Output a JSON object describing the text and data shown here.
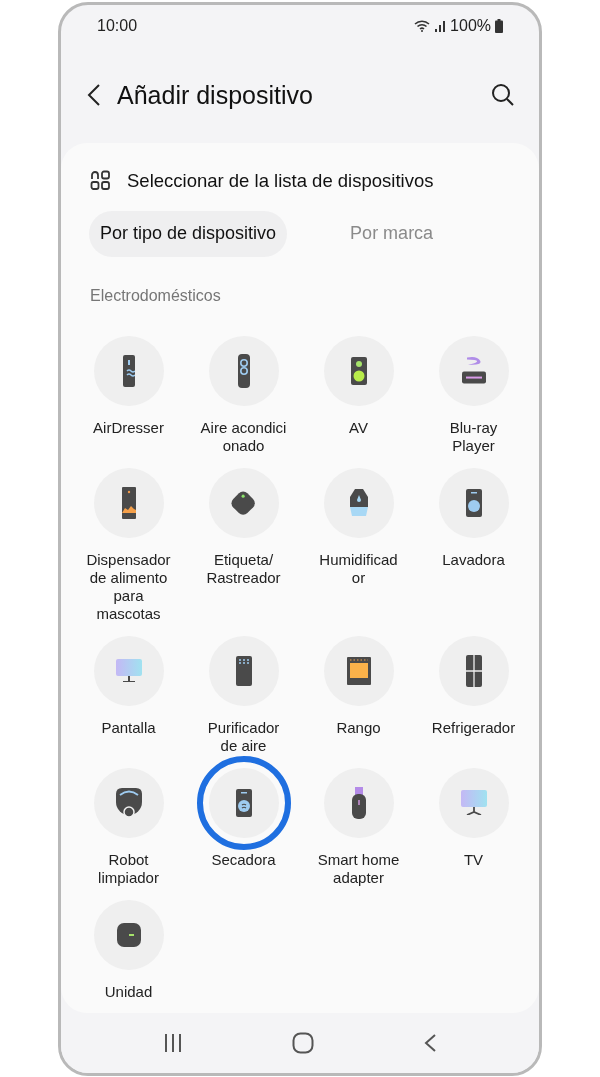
{
  "status_bar": {
    "time": "10:00",
    "battery": "100%"
  },
  "header": {
    "title": "Añadir dispositivo"
  },
  "section": {
    "title": "Seleccionar de la lista de dispositivos"
  },
  "tabs": [
    {
      "label": "Por tipo de dispositivo",
      "selected": true
    },
    {
      "label": "Por marca",
      "selected": false
    }
  ],
  "category": "Electrodomésticos",
  "devices": [
    {
      "label": "AirDresser",
      "kind": "airdresser",
      "highlighted": false
    },
    {
      "label": "Aire acondici\nonado",
      "kind": "aircon",
      "highlighted": false
    },
    {
      "label": "AV",
      "kind": "speaker",
      "highlighted": false
    },
    {
      "label": "Blu-ray\nPlayer",
      "kind": "bluray",
      "highlighted": false
    },
    {
      "label": "Dispensador\nde alimento\npara\nmascotas",
      "kind": "feeder",
      "highlighted": false
    },
    {
      "label": "Etiqueta/\nRastreador",
      "kind": "tag",
      "highlighted": false
    },
    {
      "label": "Humidificad\nor",
      "kind": "humidifier",
      "highlighted": false
    },
    {
      "label": "Lavadora",
      "kind": "washer",
      "highlighted": false
    },
    {
      "label": "Pantalla",
      "kind": "monitor",
      "highlighted": false
    },
    {
      "label": "Purificador\nde aire",
      "kind": "purifier",
      "highlighted": false
    },
    {
      "label": "Rango",
      "kind": "oven",
      "highlighted": false
    },
    {
      "label": "Refrigerador",
      "kind": "fridge",
      "highlighted": false
    },
    {
      "label": "Robot\nlimpiador",
      "kind": "robot",
      "highlighted": false
    },
    {
      "label": "Secadora",
      "kind": "dryer",
      "highlighted": true
    },
    {
      "label": "Smart home\nadapter",
      "kind": "dongle",
      "highlighted": false
    },
    {
      "label": "TV",
      "kind": "tv",
      "highlighted": false
    },
    {
      "label": "Unidad",
      "kind": "hub",
      "highlighted": false
    }
  ]
}
